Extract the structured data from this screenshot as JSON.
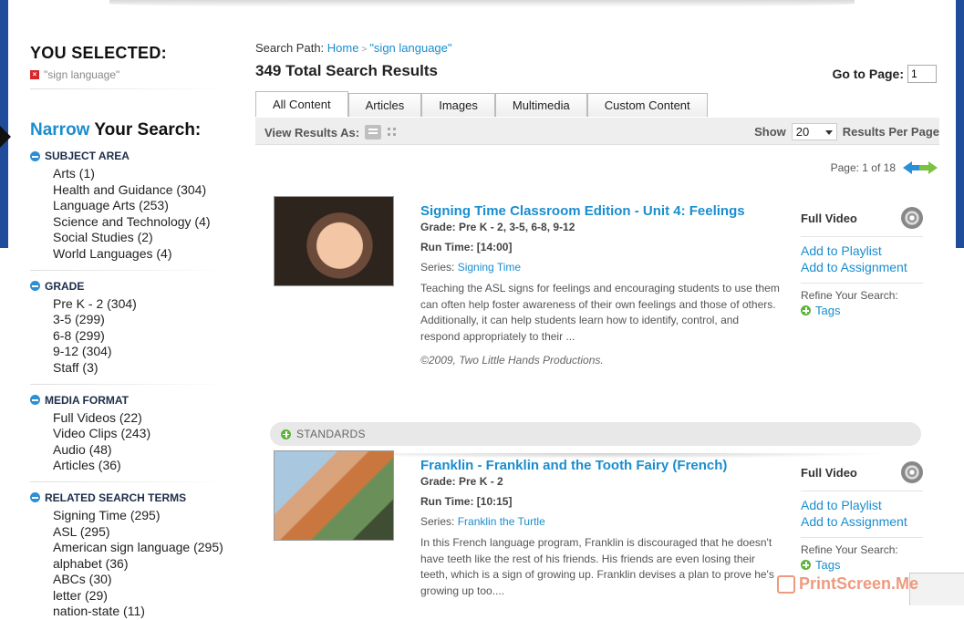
{
  "sidebar": {
    "you_selected_label": "YOU SELECTED:",
    "selected_term": "\"sign language\"",
    "narrow_prefix": "Narrow",
    "narrow_suffix": " Your Search:",
    "facets": [
      {
        "title": "SUBJECT AREA",
        "items": [
          "Arts (1)",
          "Health and Guidance (304)",
          "Language Arts (253)",
          "Science and Technology (4)",
          "Social Studies (2)",
          "World Languages (4)"
        ]
      },
      {
        "title": "GRADE",
        "items": [
          "Pre K - 2 (304)",
          "3-5 (299)",
          "6-8 (299)",
          "9-12 (304)",
          "Staff (3)"
        ]
      },
      {
        "title": "MEDIA FORMAT",
        "items": [
          "Full Videos (22)",
          "Video Clips (243)",
          "Audio (48)",
          "Articles (36)"
        ]
      },
      {
        "title": "RELATED SEARCH TERMS",
        "items": [
          "Signing Time (295)",
          "ASL (295)",
          "American sign language (295)",
          "alphabet (36)",
          "ABCs (30)",
          "letter (29)",
          "nation-state (11)"
        ]
      }
    ]
  },
  "header": {
    "search_path_label": "Search Path:",
    "search_path_home": "Home",
    "search_path_sep": ">",
    "search_path_term": "\"sign language\"",
    "total_results": "349 Total Search Results",
    "goto_label": "Go to Page:",
    "goto_value": "1"
  },
  "tabs": [
    "All Content",
    "Articles",
    "Images",
    "Multimedia",
    "Custom Content"
  ],
  "toolbar": {
    "view_as_label": "View Results As:",
    "show_label": "Show",
    "per_page_value": "20",
    "per_page_suffix": "Results Per Page"
  },
  "pager": {
    "text": "Page: 1 of 18"
  },
  "results": [
    {
      "title": "Signing Time Classroom Edition - Unit 4: Feelings",
      "grade": "Grade: Pre K - 2, 3-5, 6-8, 9-12",
      "run_time": "Run Time: [14:00]",
      "series_label": "Series:",
      "series_name": "Signing Time",
      "description": "Teaching the ASL signs for feelings and encouraging students to use them can often help foster awareness of their own feelings and those of others. Additionally, it can help students learn how to identify, control, and respond appropriately to their ...",
      "copyright": "©2009, Two Little Hands Productions.",
      "format": "Full Video",
      "add_playlist": "Add to Playlist",
      "add_assignment": "Add to Assignment",
      "refine_label": "Refine Your Search:",
      "tags_label": "Tags"
    },
    {
      "title": "Franklin - Franklin and the Tooth Fairy (French)",
      "grade": "Grade: Pre K - 2",
      "run_time": "Run Time: [10:15]",
      "series_label": "Series:",
      "series_name": "Franklin the Turtle",
      "description": "In this French language program, Franklin is discouraged that he doesn't have teeth like the rest of his friends. His friends are even losing their teeth, which is a sign of growing up. Franklin devises a plan to prove he's growing up too....",
      "format": "Full Video",
      "add_playlist": "Add to Playlist",
      "add_assignment": "Add to Assignment",
      "refine_label": "Refine Your Search:",
      "tags_label": "Tags"
    }
  ],
  "standards_label": "STANDARDS",
  "watermark": "PrintScreen.Me",
  "colors": {
    "link_blue": "#1a8dcf",
    "frame_blue": "#1f4d9c",
    "remove_red": "#d9262a",
    "plus_green": "#5cb43a"
  }
}
